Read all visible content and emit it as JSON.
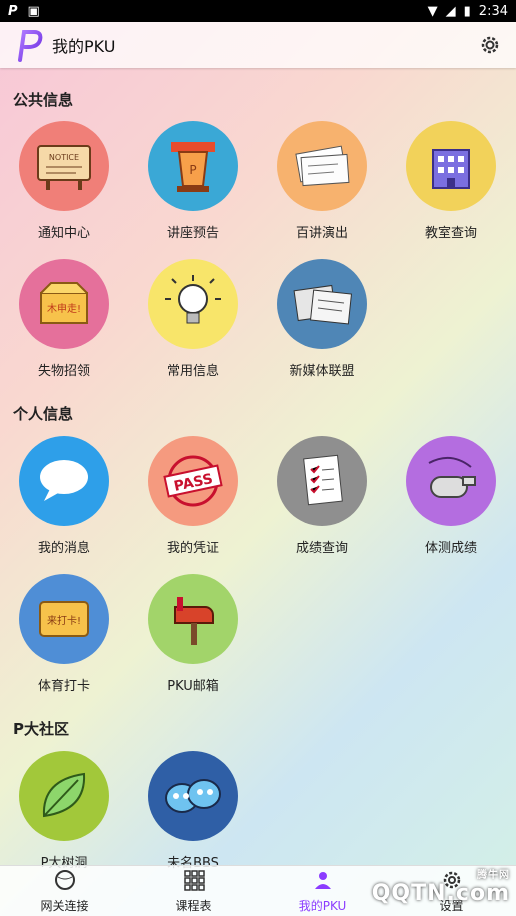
{
  "status": {
    "left_icons": [
      "p-icon",
      "image-icon"
    ],
    "time": "2:34"
  },
  "app": {
    "title": "我的PKU",
    "logo": "P"
  },
  "sections": [
    {
      "title": "公共信息",
      "items": [
        {
          "label": "通知中心",
          "icon": "notice-board-icon",
          "color": "#f07f78"
        },
        {
          "label": "讲座预告",
          "icon": "podium-icon",
          "color": "#3aa8d6"
        },
        {
          "label": "百讲演出",
          "icon": "tickets-icon",
          "color": "#f7b26e"
        },
        {
          "label": "教室查询",
          "icon": "building-icon",
          "color": "#f2d25a"
        },
        {
          "label": "失物招领",
          "icon": "lost-box-icon",
          "color": "#e5709b"
        },
        {
          "label": "常用信息",
          "icon": "lightbulb-icon",
          "color": "#f8e56a"
        },
        {
          "label": "新媒体联盟",
          "icon": "newspaper-icon",
          "color": "#4f86b6"
        }
      ]
    },
    {
      "title": "个人信息",
      "items": [
        {
          "label": "我的消息",
          "icon": "chat-bubble-icon",
          "color": "#2e9fe9"
        },
        {
          "label": "我的凭证",
          "icon": "pass-stamp-icon",
          "color": "#f59a7f"
        },
        {
          "label": "成绩查询",
          "icon": "checklist-icon",
          "color": "#8f8f8f"
        },
        {
          "label": "体测成绩",
          "icon": "whistle-icon",
          "color": "#b46de0"
        },
        {
          "label": "体育打卡",
          "icon": "checkin-sign-icon",
          "color": "#4f8ed6"
        },
        {
          "label": "PKU邮箱",
          "icon": "mailbox-icon",
          "color": "#a2d46a"
        }
      ]
    },
    {
      "title": "P大社区",
      "items": [
        {
          "label": "P大树洞",
          "icon": "leaf-icon",
          "color": "#a2c83a"
        },
        {
          "label": "未名BBS",
          "icon": "bbs-faces-icon",
          "color": "#2f5fa6"
        }
      ]
    }
  ],
  "tabs": [
    {
      "label": "网关连接",
      "icon": "globe-icon"
    },
    {
      "label": "课程表",
      "icon": "grid-icon"
    },
    {
      "label": "我的PKU",
      "icon": "person-icon",
      "active": true
    },
    {
      "label": "设置",
      "icon": "settings-icon"
    }
  ],
  "watermark": {
    "main": "QQTN.com",
    "sub": "腾牛网"
  }
}
